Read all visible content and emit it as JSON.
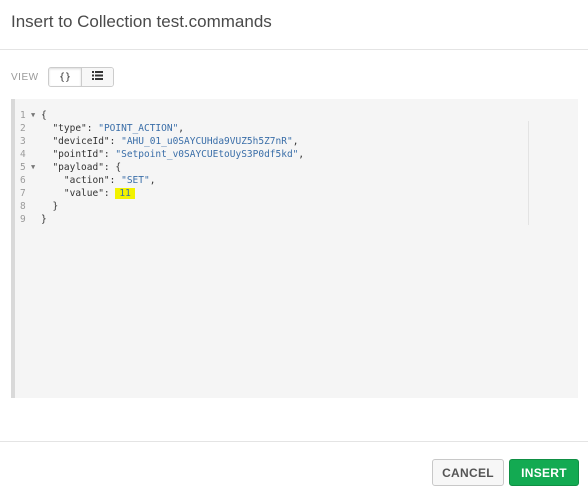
{
  "dialog": {
    "title": "Insert to Collection test.commands"
  },
  "view": {
    "label": "VIEW",
    "json_icon_glyph": "{}",
    "json_icon": "json-braces-icon",
    "list_icon": "list-icon"
  },
  "editor": {
    "lines": [
      {
        "n": "1",
        "fold": "▼",
        "parts": [
          {
            "t": "{",
            "c": "p"
          }
        ]
      },
      {
        "n": "2",
        "fold": "",
        "parts": [
          {
            "t": "  \"type\"",
            "c": "k"
          },
          {
            "t": ": ",
            "c": "p"
          },
          {
            "t": "\"POINT_ACTION\"",
            "c": "s"
          },
          {
            "t": ",",
            "c": "p"
          }
        ]
      },
      {
        "n": "3",
        "fold": "",
        "parts": [
          {
            "t": "  \"deviceId\"",
            "c": "k"
          },
          {
            "t": ": ",
            "c": "p"
          },
          {
            "t": "\"AHU_01_u0SAYCUHda9VUZ5h5Z7nR\"",
            "c": "s"
          },
          {
            "t": ",",
            "c": "p"
          }
        ]
      },
      {
        "n": "4",
        "fold": "",
        "parts": [
          {
            "t": "  \"pointId\"",
            "c": "k"
          },
          {
            "t": ": ",
            "c": "p"
          },
          {
            "t": "\"Setpoint_v0SAYCUEtoUyS3P0df5kd\"",
            "c": "s"
          },
          {
            "t": ",",
            "c": "p"
          }
        ]
      },
      {
        "n": "5",
        "fold": "▼",
        "parts": [
          {
            "t": "  \"payload\"",
            "c": "k"
          },
          {
            "t": ": {",
            "c": "p"
          }
        ]
      },
      {
        "n": "6",
        "fold": "",
        "parts": [
          {
            "t": "    \"action\"",
            "c": "k"
          },
          {
            "t": ": ",
            "c": "p"
          },
          {
            "t": "\"SET\"",
            "c": "s"
          },
          {
            "t": ",",
            "c": "p"
          }
        ]
      },
      {
        "n": "7",
        "fold": "",
        "parts": [
          {
            "t": "    \"value\"",
            "c": "k"
          },
          {
            "t": ": ",
            "c": "p"
          },
          {
            "t": "11",
            "c": "hl"
          }
        ]
      },
      {
        "n": "8",
        "fold": "",
        "parts": [
          {
            "t": "  }",
            "c": "p"
          }
        ]
      },
      {
        "n": "9",
        "fold": "",
        "parts": [
          {
            "t": "}",
            "c": "p"
          }
        ]
      }
    ]
  },
  "footer": {
    "cancel_label": "CANCEL",
    "insert_label": "INSERT"
  },
  "colors": {
    "insert_button": "#13aa52",
    "highlight": "#f2f200",
    "string": "#3a6ea8"
  }
}
